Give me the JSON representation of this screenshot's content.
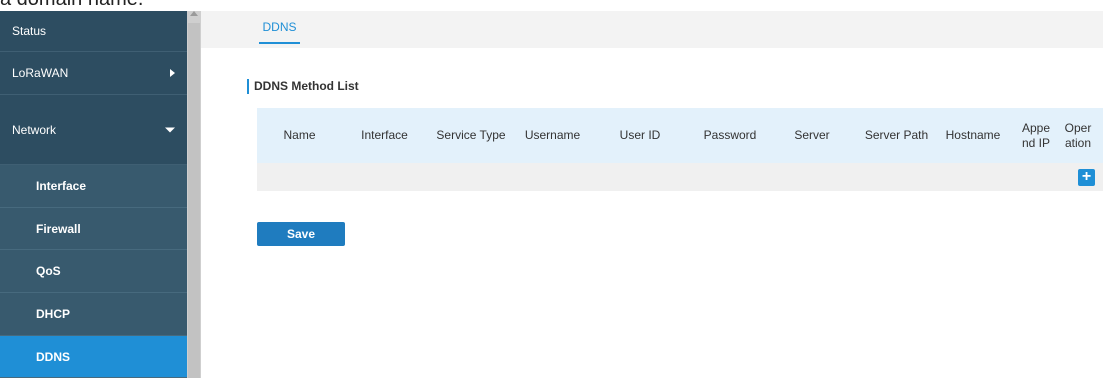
{
  "top_fragment": "a domain name.",
  "sidebar": {
    "items": [
      {
        "label": "Status"
      },
      {
        "label": "LoRaWAN"
      },
      {
        "label": "Network"
      },
      {
        "label": "Interface"
      },
      {
        "label": "Firewall"
      },
      {
        "label": "QoS"
      },
      {
        "label": "DHCP"
      },
      {
        "label": "DDNS"
      }
    ]
  },
  "tabs": [
    {
      "label": "DDNS"
    }
  ],
  "section": {
    "title": "DDNS Method List"
  },
  "table": {
    "columns": [
      "Name",
      "Interface",
      "Service Type",
      "Username",
      "User ID",
      "Password",
      "Server",
      "Server Path",
      "Hostname",
      "Appe nd IP",
      "Oper ation"
    ],
    "add_label": "+"
  },
  "actions": {
    "save_label": "Save"
  },
  "colors": {
    "sidebar_bg": "#2d4d61",
    "sidebar_sub_bg": "#385a6e",
    "active": "#1f8fd6",
    "table_header_bg": "#e3f1fb",
    "save_button": "#1f7cbf"
  },
  "icons": {
    "expand": "chevron-right-icon",
    "collapse": "chevron-down-icon",
    "add": "plus-icon"
  }
}
